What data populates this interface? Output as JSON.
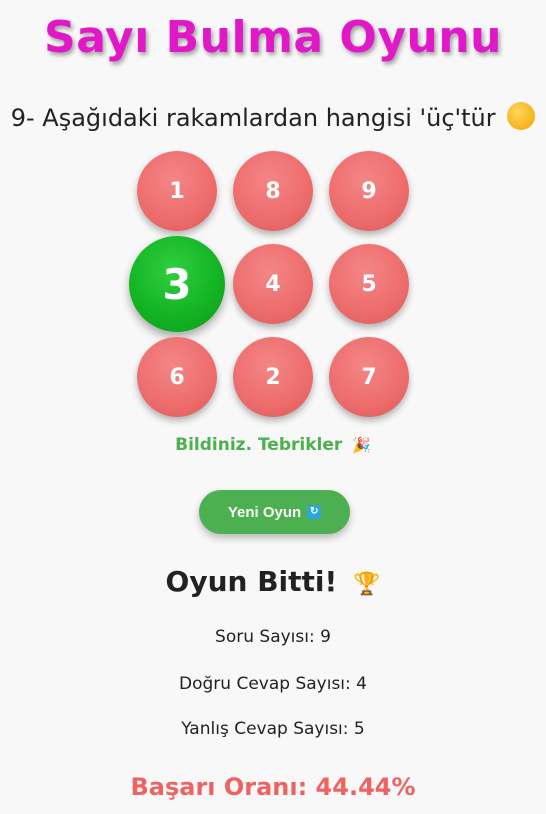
{
  "title": "Sayı Bulma Oyunu",
  "question": "9- Aşağıdaki rakamlardan hangisi 'üç'tür",
  "question_emoji": "thinking-face-icon",
  "numbers": [
    "1",
    "8",
    "9",
    "3",
    "4",
    "5",
    "6",
    "2",
    "7"
  ],
  "correct_index": 3,
  "feedback": "Bildiniz. Tebrikler",
  "feedback_emoji": "party-popper-icon",
  "new_game_label": "Yeni Oyun",
  "new_game_icon": "refresh-icon",
  "game_over": "Oyun Bitti!",
  "game_over_emoji": "trophy-icon",
  "stats": {
    "questions": "Soru Sayısı: 9",
    "correct": "Doğru Cevap Sayısı: 4",
    "wrong": "Yanlış Cevap Sayısı: 5"
  },
  "success_rate": "Başarı Oranı: 44.44%",
  "colors": {
    "title": "#e018c8",
    "ball": "#ee6e6e",
    "correct_ball": "#14b524",
    "feedback": "#4caf50",
    "button": "#4caf50",
    "rate": "#f06262"
  }
}
